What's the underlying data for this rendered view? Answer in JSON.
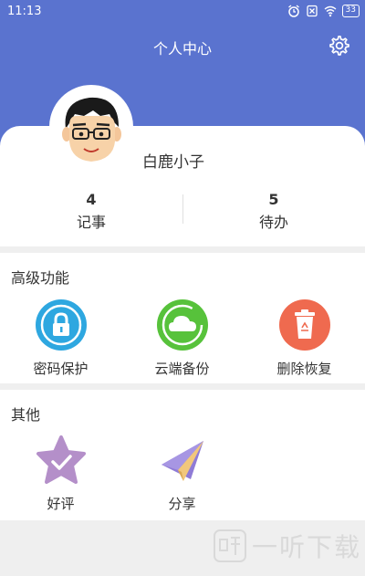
{
  "status_bar": {
    "time": "11:13",
    "battery": "33"
  },
  "header": {
    "title": "个人中心"
  },
  "profile": {
    "username": "白鹿小子",
    "stats": [
      {
        "count": "4",
        "label": "记事"
      },
      {
        "count": "5",
        "label": "待办"
      }
    ]
  },
  "advanced": {
    "title": "高级功能",
    "items": [
      {
        "label": "密码保护",
        "icon": "lock-icon",
        "color": "#2ea7e0"
      },
      {
        "label": "云端备份",
        "icon": "cloud-icon",
        "color": "#57c23b"
      },
      {
        "label": "删除恢复",
        "icon": "recycle-bin-icon",
        "color": "#ef6a4f"
      }
    ]
  },
  "other": {
    "title": "其他",
    "items": [
      {
        "label": "好评",
        "icon": "star-check-icon",
        "color": "#b48fc9"
      },
      {
        "label": "分享",
        "icon": "paper-plane-icon",
        "color": "#8f7bd6"
      }
    ]
  },
  "watermark": {
    "text": "一听下载"
  },
  "colors": {
    "header": "#5a73cf",
    "background": "#efefef"
  }
}
